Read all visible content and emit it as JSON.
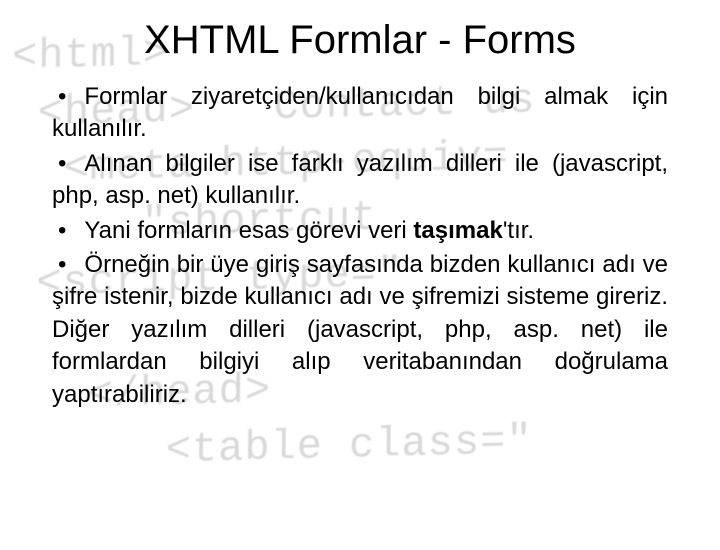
{
  "background_code": "<html>\n <head>   Contact us\n  <meta http-equiv=\n     \"shortcut\n <script type=\"\n\n   </head>\n      <table class=\"",
  "title": "XHTML Formlar - Forms",
  "bullets": [
    {
      "pre": "Formlar ziyaretçiden/kullanıcıdan bilgi almak için kullanılır.",
      "bold": "",
      "post": ""
    },
    {
      "pre": "Alınan bilgiler ise farklı yazılım dilleri ile (javascript, php, asp. net) kullanılır.",
      "bold": "",
      "post": ""
    },
    {
      "pre": "Yani formların esas görevi veri ",
      "bold": "taşımak",
      "post": "'tır."
    },
    {
      "pre": "Örneğin bir üye giriş sayfasında bizden kullanıcı adı ve şifre istenir, bizde kullanıcı adı ve şifremizi sisteme gireriz. Diğer yazılım dilleri (javascript, php, asp. net) ile formlardan bilgiyi alıp veritabanından doğrulama yaptırabiliriz.",
      "bold": "",
      "post": ""
    }
  ]
}
